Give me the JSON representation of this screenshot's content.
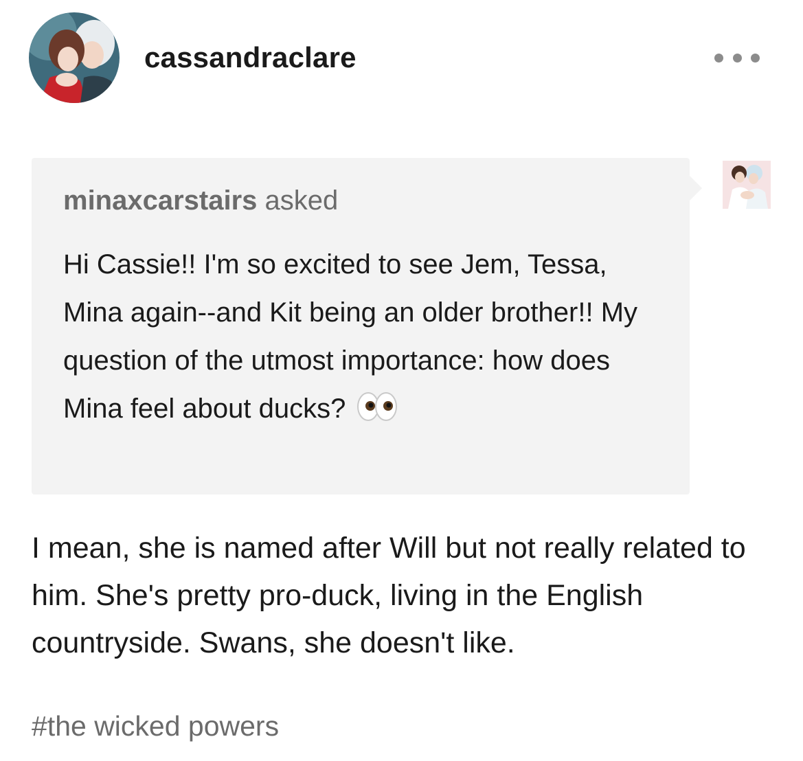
{
  "post": {
    "blog_name": "cassandraclare",
    "avatar_icon": "blog-avatar-illustration",
    "more_icon": "ellipsis-icon"
  },
  "ask": {
    "asker": "minaxcarstairs",
    "asked_label": "asked",
    "question": "Hi Cassie!! I'm so excited to see Jem, Tessa, Mina again--and Kit being an older brother!! My question of the utmost importance: how does Mina feel about ducks?",
    "emoji": "eyes-emoji"
  },
  "answer": {
    "text": "I mean, she is named after Will but not really related to him. She's pretty pro-duck, living in the English countryside. Swans, she doesn't like."
  },
  "tags": [
    "#the wicked powers"
  ],
  "colors": {
    "ask_background": "#f3f3f3",
    "muted_text": "#6b6b6b",
    "primary_text": "#1a1a1a"
  }
}
